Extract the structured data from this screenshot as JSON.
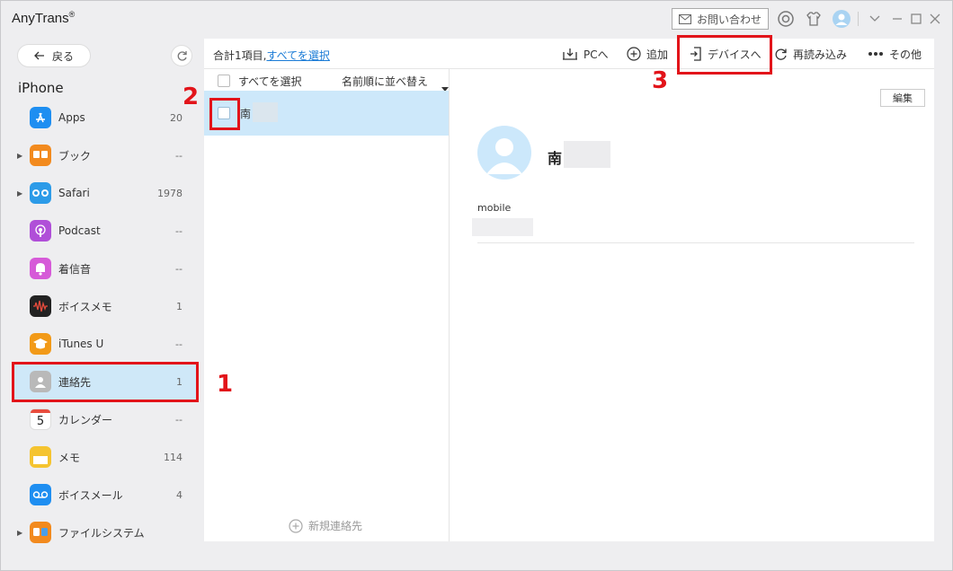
{
  "app": {
    "title": "AnyTrans",
    "mark": "®"
  },
  "titlebar": {
    "contact_label": "お問い合わせ"
  },
  "sidebar": {
    "back_label": "戻る",
    "device_name": "iPhone",
    "items": [
      {
        "label": "Apps",
        "count": "20",
        "expandable": false,
        "icon": "app-store-icon",
        "color": "#1e8ef1"
      },
      {
        "label": "ブック",
        "count": "--",
        "expandable": true,
        "icon": "books-icon",
        "color": "#f28a1e"
      },
      {
        "label": "Safari",
        "count": "1978",
        "expandable": true,
        "icon": "safari-icon",
        "color": "#2c9be8"
      },
      {
        "label": "Podcast",
        "count": "--",
        "expandable": false,
        "icon": "podcast-icon",
        "color": "#b04fd8"
      },
      {
        "label": "着信音",
        "count": "--",
        "expandable": false,
        "icon": "bell-icon",
        "color": "#d65ad8"
      },
      {
        "label": "ボイスメモ",
        "count": "1",
        "expandable": false,
        "icon": "voice-memo-icon",
        "color": "#222222"
      },
      {
        "label": "iTunes U",
        "count": "--",
        "expandable": false,
        "icon": "itunes-u-icon",
        "color": "#f29a18"
      },
      {
        "label": "連絡先",
        "count": "1",
        "expandable": false,
        "icon": "contacts-icon",
        "color": "#b9b9b9"
      },
      {
        "label": "カレンダー",
        "count": "--",
        "expandable": false,
        "icon": "calendar-icon",
        "color": "#ffffff"
      },
      {
        "label": "メモ",
        "count": "114",
        "expandable": false,
        "icon": "notes-icon",
        "color": "#f5c430"
      },
      {
        "label": "ボイスメール",
        "count": "4",
        "expandable": false,
        "icon": "voicemail-icon",
        "color": "#1e8ef1"
      },
      {
        "label": "ファイルシステム",
        "count": "",
        "expandable": true,
        "icon": "file-system-icon",
        "color": "#f28a1e"
      }
    ],
    "calendar_day": "5"
  },
  "toolbar": {
    "summary_prefix": "合計1項目,",
    "select_all_link": "すべてを選択",
    "to_pc": "PCへ",
    "add": "追加",
    "to_device": "デバイスへ",
    "reload": "再読み込み",
    "more": "その他"
  },
  "list": {
    "select_all": "すべてを選択",
    "sort": "名前順に並べ替える",
    "contact_name_prefix": "南",
    "new_contact": "新規連絡先"
  },
  "detail": {
    "edit": "編集",
    "name_prefix": "南",
    "field_label": "mobile"
  },
  "annotations": [
    "1",
    "2",
    "3"
  ],
  "colors": {
    "accent": "#1a7bd6",
    "highlight": "#e2141a",
    "selection": "#cde8fa"
  }
}
